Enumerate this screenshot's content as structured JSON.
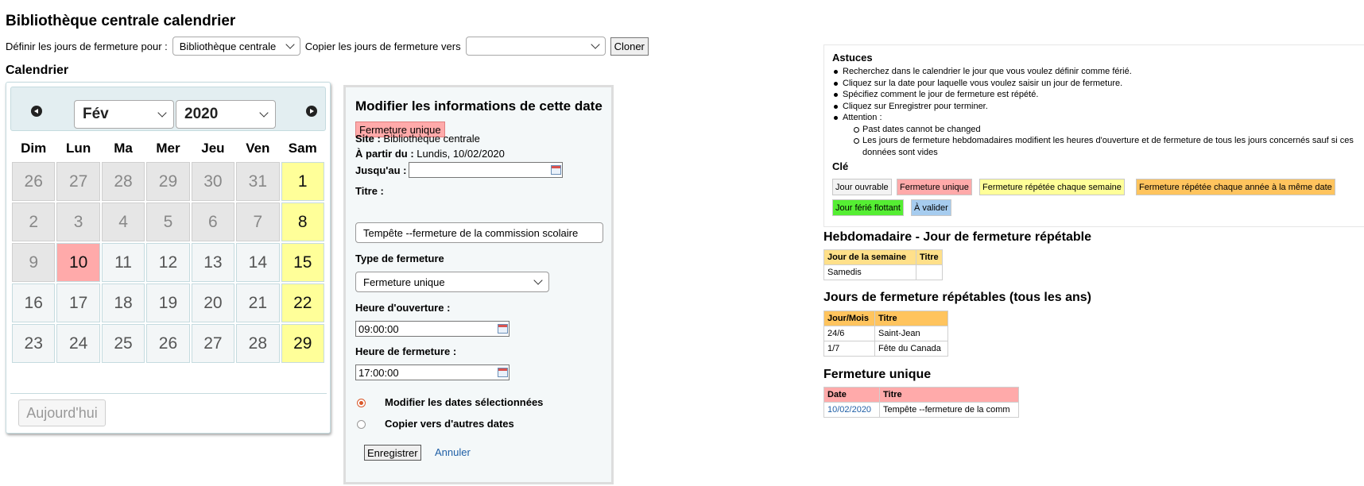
{
  "page_title": "Bibliothèque centrale calendrier",
  "toolbar": {
    "define_label": "Définir les jours de fermeture pour :",
    "library_select": "Bibliothèque centrale",
    "copy_label": "Copier les jours de fermeture vers",
    "copy_select": "",
    "clone_button": "Cloner"
  },
  "calendar_heading": "Calendrier",
  "calendar": {
    "month": "Fév",
    "year": "2020",
    "weekdays": [
      "Dim",
      "Lun",
      "Ma",
      "Mer",
      "Jeu",
      "Ven",
      "Sam"
    ],
    "weeks": [
      [
        {
          "d": "26",
          "t": "other"
        },
        {
          "d": "27",
          "t": "other"
        },
        {
          "d": "28",
          "t": "other"
        },
        {
          "d": "29",
          "t": "other"
        },
        {
          "d": "30",
          "t": "other"
        },
        {
          "d": "31",
          "t": "other"
        },
        {
          "d": "1",
          "t": "sat"
        }
      ],
      [
        {
          "d": "2",
          "t": "other"
        },
        {
          "d": "3",
          "t": "other"
        },
        {
          "d": "4",
          "t": "other"
        },
        {
          "d": "5",
          "t": "other"
        },
        {
          "d": "6",
          "t": "other"
        },
        {
          "d": "7",
          "t": "other"
        },
        {
          "d": "8",
          "t": "sat"
        }
      ],
      [
        {
          "d": "9",
          "t": "other"
        },
        {
          "d": "10",
          "t": "unique"
        },
        {
          "d": "11",
          "t": "work"
        },
        {
          "d": "12",
          "t": "work"
        },
        {
          "d": "13",
          "t": "work"
        },
        {
          "d": "14",
          "t": "work"
        },
        {
          "d": "15",
          "t": "sat"
        }
      ],
      [
        {
          "d": "16",
          "t": "work"
        },
        {
          "d": "17",
          "t": "work"
        },
        {
          "d": "18",
          "t": "work"
        },
        {
          "d": "19",
          "t": "work"
        },
        {
          "d": "20",
          "t": "work"
        },
        {
          "d": "21",
          "t": "work"
        },
        {
          "d": "22",
          "t": "sat"
        }
      ],
      [
        {
          "d": "23",
          "t": "work"
        },
        {
          "d": "24",
          "t": "work"
        },
        {
          "d": "25",
          "t": "work"
        },
        {
          "d": "26",
          "t": "work"
        },
        {
          "d": "27",
          "t": "work"
        },
        {
          "d": "28",
          "t": "work"
        },
        {
          "d": "29",
          "t": "sat"
        }
      ]
    ],
    "today_button": "Aujourd'hui"
  },
  "edit_panel": {
    "title": "Modifier les informations de cette date",
    "badge": "Fermeture unique",
    "site_label": "Site :",
    "site_value": "Bibliothèque centrale",
    "from_label": "À partir du :",
    "from_value": "Lundis, 10/02/2020",
    "until_label": "Jusqu'au :",
    "until_value": "",
    "title_label": "Titre :",
    "title_value": "Tempête --fermeture de la commission scolaire",
    "type_label": "Type de fermeture",
    "type_value": "Fermeture unique",
    "open_label": "Heure d'ouverture :",
    "open_value": "09:00:00",
    "close_label": "Heure de fermeture :",
    "close_value": "17:00:00",
    "radio_modify": "Modifier les dates sélectionnées",
    "radio_copy": "Copier vers d'autres dates",
    "save_button": "Enregistrer",
    "cancel_link": "Annuler"
  },
  "tips": {
    "title": "Astuces",
    "items": [
      "Recherchez dans le calendrier le jour que vous voulez définir comme férié.",
      "Cliquez sur la date pour laquelle vous voulez saisir un jour de fermeture.",
      "Spécifiez comment le jour de fermeture est répété.",
      "Cliquez sur Enregistrer pour terminer.",
      "Attention :"
    ],
    "sub_items": [
      "Past dates cannot be changed",
      "Les jours de fermeture hebdomadaires modifient les heures d'ouverture et de fermeture de tous les jours concernés sauf si ces données sont vides"
    ],
    "key_title": "Clé",
    "keys": {
      "work": "Jour ouvrable",
      "unique": "Fermeture unique",
      "week": "Fermeture répétée chaque semaine",
      "year": "Fermeture répétée chaque année à la même date",
      "float": "Jour férié flottant",
      "valid": "À valider"
    }
  },
  "weekly": {
    "heading": "Hebdomadaire - Jour de fermeture répétable",
    "headers": [
      "Jour de la semaine",
      "Titre"
    ],
    "rows": [
      [
        "Samedis",
        ""
      ]
    ]
  },
  "yearly": {
    "heading": "Jours de fermeture répétables (tous les ans)",
    "headers": [
      "Jour/Mois",
      "Titre"
    ],
    "rows": [
      [
        "24/6",
        "Saint-Jean"
      ],
      [
        "1/7",
        "Fête du Canada"
      ]
    ]
  },
  "unique": {
    "heading": "Fermeture unique",
    "headers": [
      "Date",
      "Titre"
    ],
    "rows": [
      [
        "10/02/2020",
        "Tempête --fermeture de la comm"
      ]
    ]
  }
}
